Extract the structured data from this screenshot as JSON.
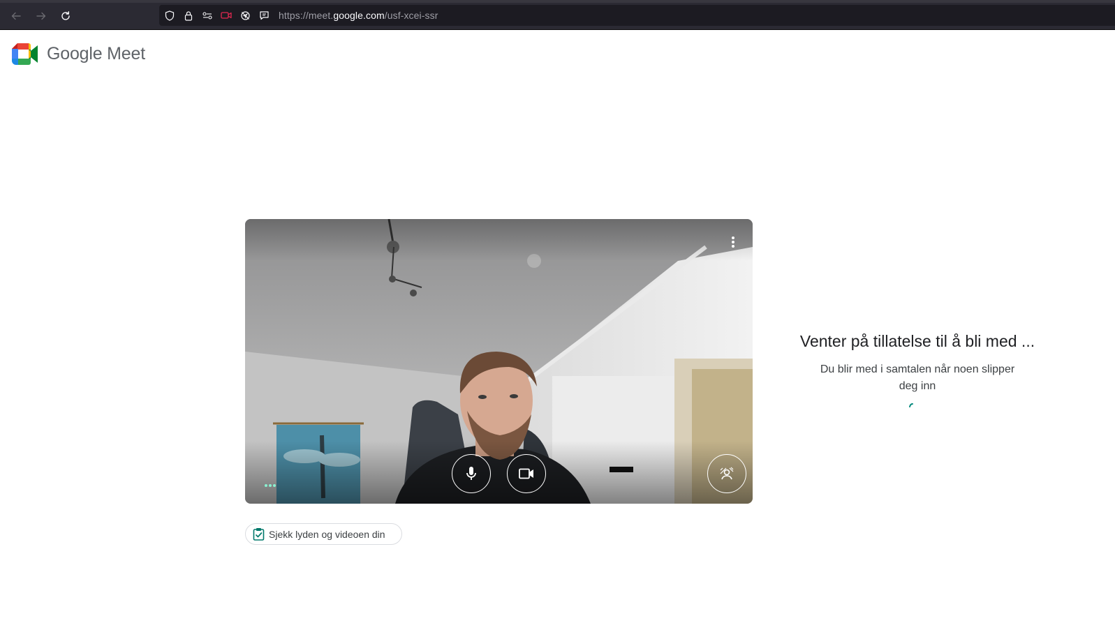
{
  "browser": {
    "url_scheme": "https://meet.",
    "url_host": "google.com",
    "url_path": "/usf-xcei-ssr",
    "icons": [
      "back-arrow-icon",
      "forward-arrow-icon",
      "reload-icon",
      "shield-icon",
      "lock-icon",
      "permissions-icon",
      "camera-active-icon",
      "location-blocked-icon",
      "reader-view-icon"
    ]
  },
  "header": {
    "logo_text": "Google Meet"
  },
  "preview": {
    "mic_icon": "mic-icon",
    "camera_icon": "videocam-icon",
    "effects_icon": "visual-effects-icon",
    "more_icon": "more-vert-icon"
  },
  "check_button": {
    "label": "Sjekk lyden og videoen din",
    "icon": "clipboard-check-icon"
  },
  "waiting": {
    "title": "Venter på tillatelse til å bli med ...",
    "subtitle": "Du blir med i samtalen når noen slipper deg inn"
  },
  "colors": {
    "toolbar": "#2b2a33",
    "urlbar": "#1c1b22",
    "camera_active": "#e22850",
    "accent_teal": "#00897b"
  }
}
